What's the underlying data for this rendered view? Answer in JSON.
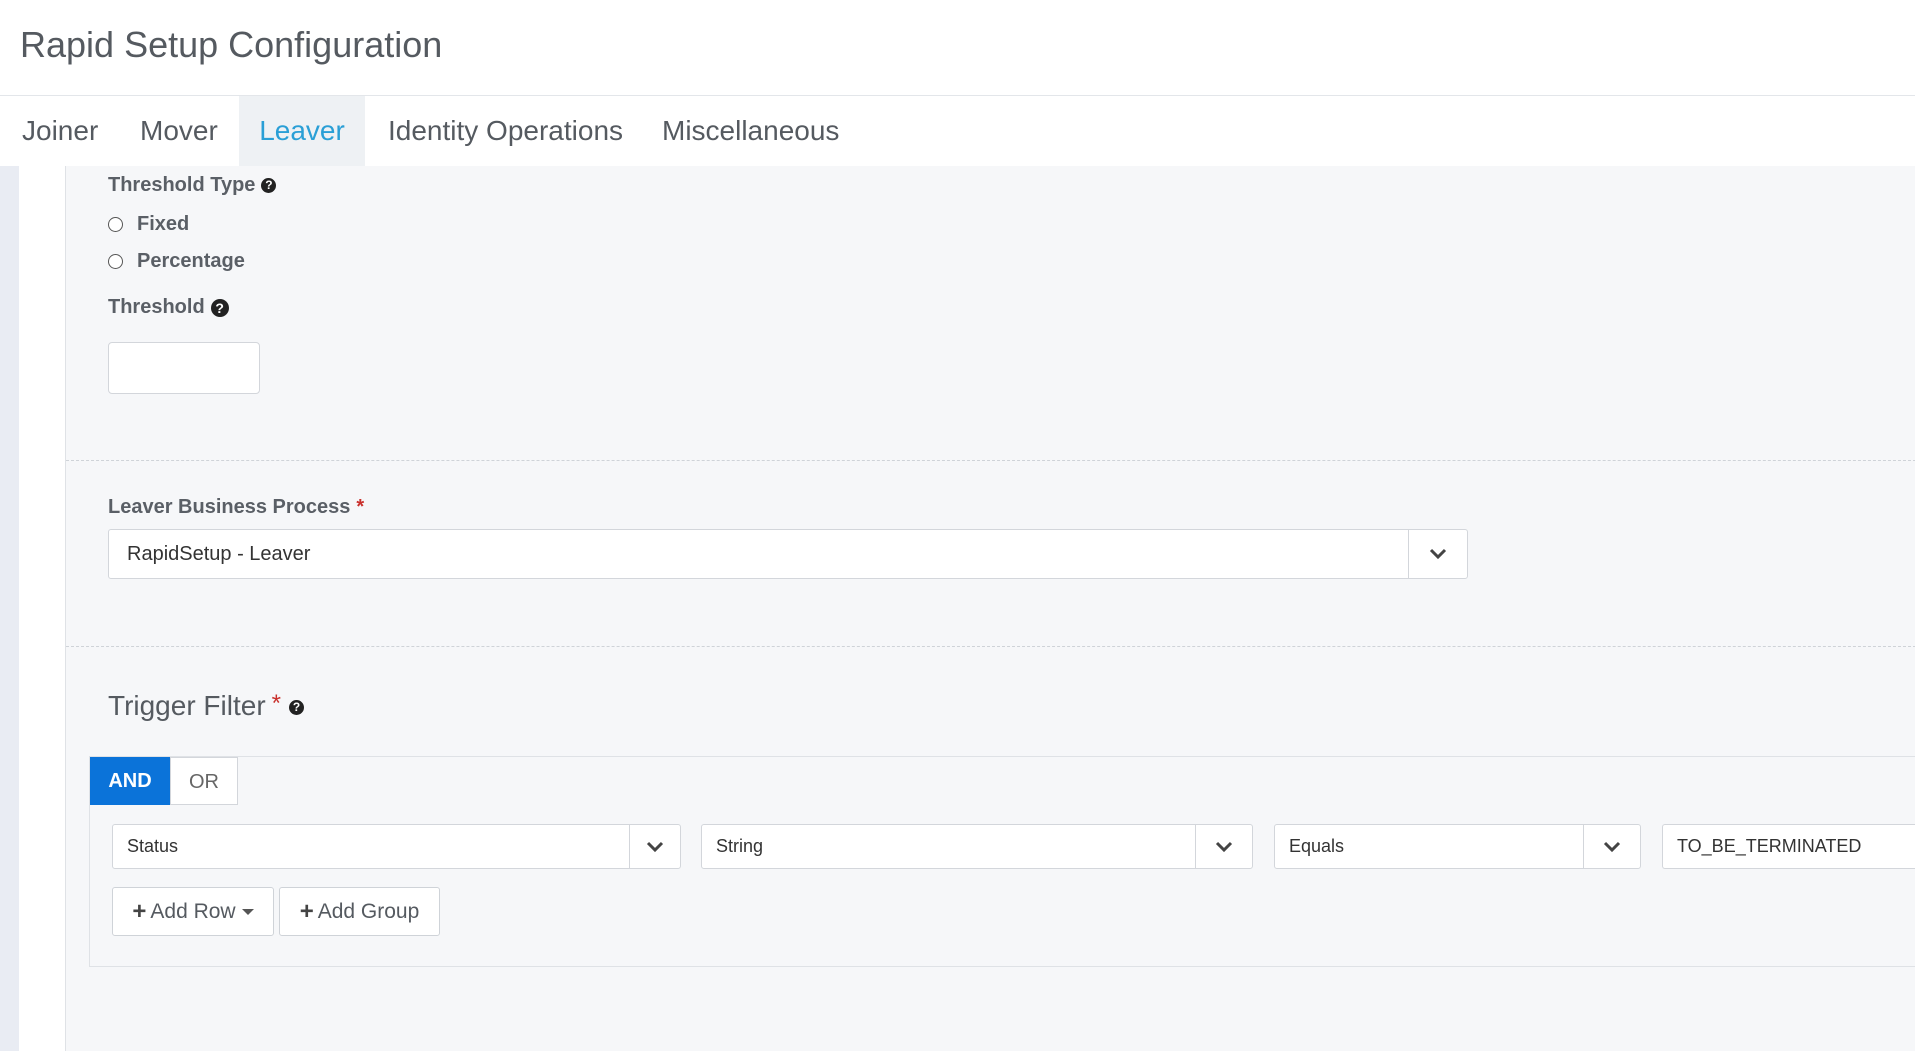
{
  "header": {
    "title": "Rapid Setup Configuration"
  },
  "tabs": [
    {
      "label": "Joiner",
      "active": false
    },
    {
      "label": "Mover",
      "active": false
    },
    {
      "label": "Leaver",
      "active": true
    },
    {
      "label": "Identity Operations",
      "active": false
    },
    {
      "label": "Miscellaneous",
      "active": false
    }
  ],
  "threshold_type": {
    "label": "Threshold Type",
    "options": [
      "Fixed",
      "Percentage"
    ],
    "help_icon": "question-circle-icon"
  },
  "threshold": {
    "label": "Threshold",
    "value": "",
    "help_icon": "question-circle-icon"
  },
  "business_process": {
    "label": "Leaver Business Process",
    "required_mark": "*",
    "selected": "RapidSetup - Leaver",
    "caret_icon": "chevron-down-icon"
  },
  "trigger_filter": {
    "title": "Trigger Filter",
    "required_mark": "*",
    "help_icon": "question-circle-icon",
    "logic": {
      "and_label": "AND",
      "or_label": "OR",
      "selected": "AND"
    },
    "rule": {
      "field": "Status",
      "type": "String",
      "operator": "Equals",
      "value": "TO_BE_TERMINATED"
    },
    "add_row_label": "Add Row",
    "add_group_label": "Add Group"
  },
  "colors": {
    "accent_tab": "#2a9fd6",
    "and_button": "#0b73d9",
    "required": "#c9302c",
    "panel_bg": "#f6f7f9"
  }
}
